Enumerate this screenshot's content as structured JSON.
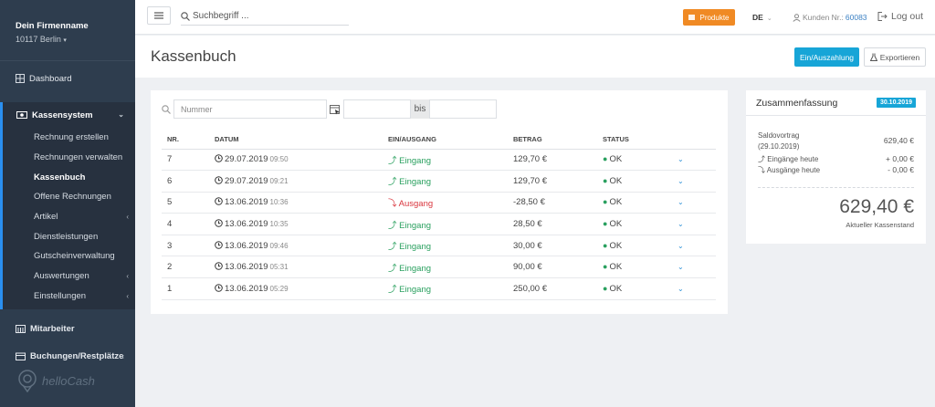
{
  "company": {
    "name": "Dein Firmenname",
    "city": "10117 Berlin",
    "caret": "▾"
  },
  "sidebar": {
    "dashboard": "Dashboard",
    "section": "Kassensystem",
    "items": [
      {
        "label": "Rechnung erstellen",
        "chevron": ""
      },
      {
        "label": "Rechnungen verwalten",
        "chevron": ""
      },
      {
        "label": "Kassenbuch",
        "chevron": ""
      },
      {
        "label": "Offene Rechnungen",
        "chevron": ""
      },
      {
        "label": "Artikel",
        "chevron": "‹"
      },
      {
        "label": "Dienstleistungen",
        "chevron": ""
      },
      {
        "label": "Gutscheinverwaltung",
        "chevron": ""
      },
      {
        "label": "Auswertungen",
        "chevron": "‹"
      },
      {
        "label": "Einstellungen",
        "chevron": "‹"
      }
    ],
    "mitarbeiter": "Mitarbeiter",
    "buchungen": "Buchungen/Restplätze",
    "logo_text": "helloCash"
  },
  "topbar": {
    "search_placeholder": "Suchbegriff ...",
    "produkte": "Produkte",
    "lang": "DE",
    "kunden_label": "Kunden Nr.:",
    "kunden_nr": "60083",
    "logout": "Log out"
  },
  "page": {
    "title": "Kassenbuch",
    "btn_primary": "Ein/Auszahlung",
    "btn_export": "Exportieren"
  },
  "filters": {
    "number_placeholder": "Nummer",
    "bis": "bis"
  },
  "table": {
    "headers": [
      "NR.",
      "DATUM",
      "EIN/AUSGANG",
      "BETRAG",
      "STATUS"
    ],
    "rows": [
      {
        "nr": "7",
        "date": "29.07.2019",
        "time": "09:50",
        "type": "Eingang",
        "dir": "in",
        "amount": "129,70 €",
        "status": "OK"
      },
      {
        "nr": "6",
        "date": "29.07.2019",
        "time": "09:21",
        "type": "Eingang",
        "dir": "in",
        "amount": "129,70 €",
        "status": "OK"
      },
      {
        "nr": "5",
        "date": "13.06.2019",
        "time": "10:36",
        "type": "Ausgang",
        "dir": "out",
        "amount": "-28,50 €",
        "status": "OK"
      },
      {
        "nr": "4",
        "date": "13.06.2019",
        "time": "10:35",
        "type": "Eingang",
        "dir": "in",
        "amount": "28,50 €",
        "status": "OK"
      },
      {
        "nr": "3",
        "date": "13.06.2019",
        "time": "09:46",
        "type": "Eingang",
        "dir": "in",
        "amount": "30,00 €",
        "status": "OK"
      },
      {
        "nr": "2",
        "date": "13.06.2019",
        "time": "05:31",
        "type": "Eingang",
        "dir": "in",
        "amount": "90,00 €",
        "status": "OK"
      },
      {
        "nr": "1",
        "date": "13.06.2019",
        "time": "05:29",
        "type": "Eingang",
        "dir": "in",
        "amount": "250,00 €",
        "status": "OK"
      }
    ]
  },
  "summary": {
    "title": "Zusammenfassung",
    "date": "30.10.2019",
    "saldo_label": "Saldovortrag",
    "saldo_date": "(29.10.2019)",
    "saldo_value": "629,40 €",
    "eingaenge_label": "Eingänge heute",
    "eingaenge_value": "+ 0,00 €",
    "ausgaenge_label": "Ausgänge heute",
    "ausgaenge_value": "- 0,00 €",
    "total": "629,40 €",
    "total_label": "Aktueller Kassenstand"
  },
  "colors": {
    "sidebar": "#2e3d4e",
    "accent_blue": "#17a5d7",
    "orange": "#f08a24",
    "green": "#2aa05f",
    "red": "#d9363e"
  }
}
